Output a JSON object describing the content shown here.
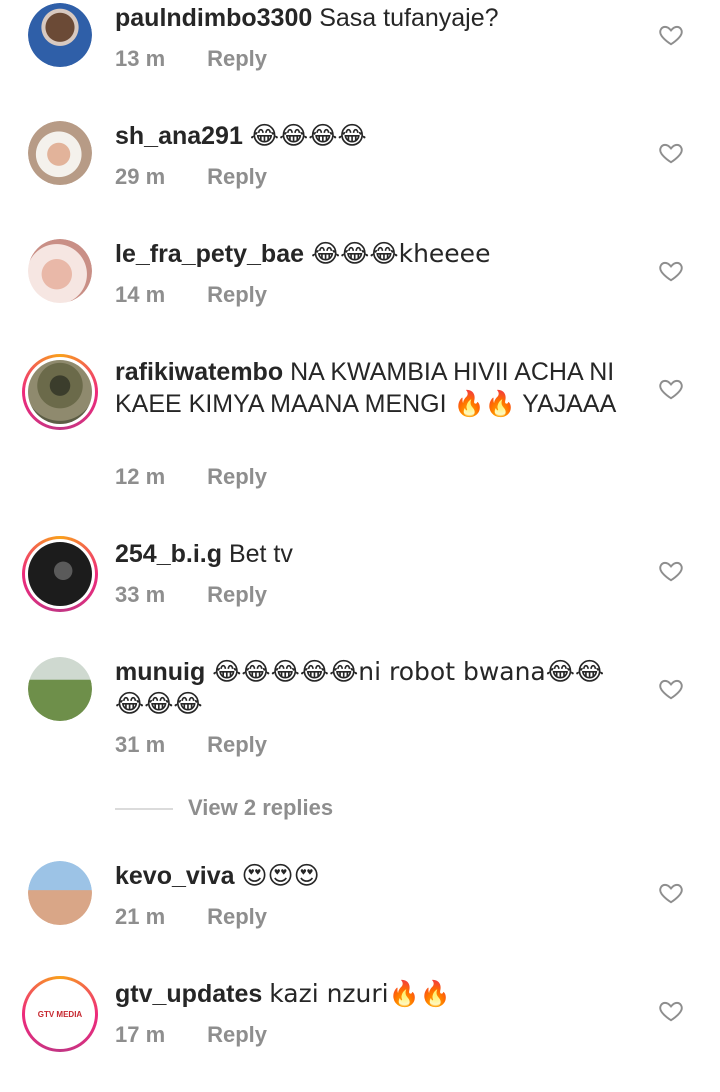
{
  "comments": [
    {
      "username": "paulndimbo3300",
      "text": "Sasa tufanyaje?",
      "time": "13 m",
      "reply": "Reply"
    },
    {
      "username": "sh_ana291",
      "text": "😂😂😂😂",
      "time": "29 m",
      "reply": "Reply"
    },
    {
      "username": "le_fra_pety_bae",
      "text": "😂😂😂kheeee",
      "time": "14 m",
      "reply": "Reply"
    },
    {
      "username": "rafikiwatembo",
      "text": "NA KWAMBIA HIVII ACHA NI KAEE KIMYA MAANA MENGI 🔥🔥 YAJAAA",
      "time": "12 m",
      "reply": "Reply"
    },
    {
      "username": "254_b.i.g",
      "text": "Bet tv",
      "time": "33 m",
      "reply": "Reply"
    },
    {
      "username": "munuig",
      "text": "😂😂😂😂😂ni robot bwana😂😂 😂😂😂",
      "time": "31 m",
      "reply": "Reply"
    },
    {
      "username": "kevo_viva",
      "text": "😍😍😍",
      "time": "21 m",
      "reply": "Reply"
    },
    {
      "username": "gtv_updates",
      "text": "kazi nzuri🔥🔥",
      "time": "17 m",
      "reply": "Reply"
    }
  ],
  "view_replies": "View 2 replies",
  "colors": {
    "text": "#262626",
    "meta": "#8e8e8e",
    "ring_start": "#f9a11b",
    "ring_end": "#c13584"
  },
  "icons": {
    "like": "heart-outline-icon"
  },
  "avatar_logo_text": "GTV MEDIA"
}
